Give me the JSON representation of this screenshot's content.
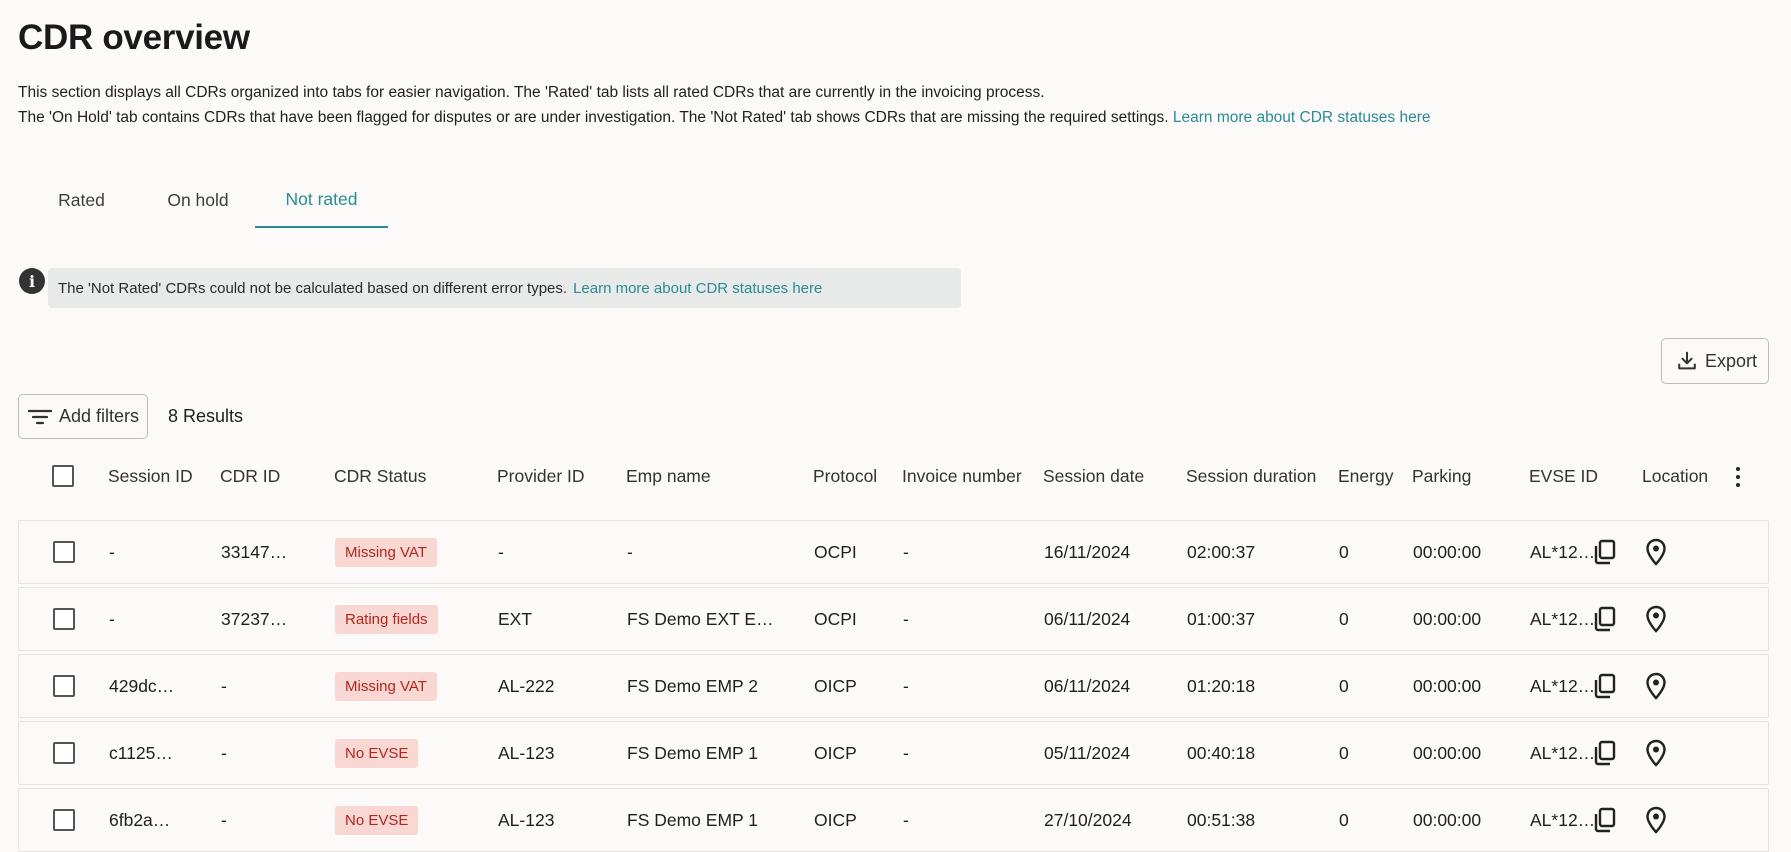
{
  "page": {
    "title": "CDR overview",
    "description_line1": "This section displays all CDRs organized into tabs for easier navigation. The 'Rated' tab lists all rated CDRs that are currently in the invoicing process.",
    "description_line2": "The 'On Hold' tab contains CDRs that have been flagged for disputes or are under investigation. The 'Not Rated' tab shows CDRs that are missing the required settings.",
    "description_link": "Learn more about CDR statuses here"
  },
  "tabs": [
    {
      "label": "Rated",
      "active": false
    },
    {
      "label": "On hold",
      "active": false
    },
    {
      "label": "Not rated",
      "active": true
    }
  ],
  "info": {
    "text": "The 'Not Rated' CDRs could not be calculated based on different error types.",
    "link": "Learn more about CDR statuses here"
  },
  "toolbar": {
    "export_label": "Export",
    "add_filters_label": "Add filters",
    "results_text": "8 Results"
  },
  "table": {
    "headers": [
      "Session ID",
      "CDR ID",
      "CDR Status",
      "Provider ID",
      "Emp name",
      "Protocol",
      "Invoice number",
      "Session date",
      "Session duration",
      "Energy",
      "Parking",
      "EVSE ID",
      "Location"
    ],
    "rows": [
      {
        "session_id": "-",
        "cdr_id": "33147…",
        "status": "Missing VAT",
        "provider_id": "-",
        "emp_name": "-",
        "protocol": "OCPI",
        "invoice": "-",
        "date": "16/11/2024",
        "duration": "02:00:37",
        "energy": "0",
        "parking": "00:00:00",
        "evse": "AL*12…"
      },
      {
        "session_id": "-",
        "cdr_id": "37237…",
        "status": "Rating fields",
        "provider_id": "EXT",
        "emp_name": "FS Demo EXT E…",
        "protocol": "OCPI",
        "invoice": "-",
        "date": "06/11/2024",
        "duration": "01:00:37",
        "energy": "0",
        "parking": "00:00:00",
        "evse": "AL*12…"
      },
      {
        "session_id": "429dc…",
        "cdr_id": "-",
        "status": "Missing VAT",
        "provider_id": "AL-222",
        "emp_name": "FS Demo EMP 2",
        "protocol": "OICP",
        "invoice": "-",
        "date": "06/11/2024",
        "duration": "01:20:18",
        "energy": "0",
        "parking": "00:00:00",
        "evse": "AL*12…"
      },
      {
        "session_id": "c1125…",
        "cdr_id": "-",
        "status": "No EVSE",
        "provider_id": "AL-123",
        "emp_name": "FS Demo EMP 1",
        "protocol": "OICP",
        "invoice": "-",
        "date": "05/11/2024",
        "duration": "00:40:18",
        "energy": "0",
        "parking": "00:00:00",
        "evse": "AL*12…"
      },
      {
        "session_id": "6fb2a…",
        "cdr_id": "-",
        "status": "No EVSE",
        "provider_id": "AL-123",
        "emp_name": "FS Demo EMP 1",
        "protocol": "OICP",
        "invoice": "-",
        "date": "27/10/2024",
        "duration": "00:51:38",
        "energy": "0",
        "parking": "00:00:00",
        "evse": "AL*12…"
      }
    ]
  },
  "icons": {
    "info": "info-icon",
    "export": "download-icon",
    "filters": "filter-icon",
    "more": "more-vertical-icon",
    "copy": "copy-icon",
    "location": "location-pin-icon"
  },
  "colors": {
    "accent": "#2a8b97",
    "badge_bg": "#f9d7d2",
    "badge_text": "#b3261e",
    "info_bg": "#e8eaea",
    "page_bg": "#fbfaf8"
  }
}
